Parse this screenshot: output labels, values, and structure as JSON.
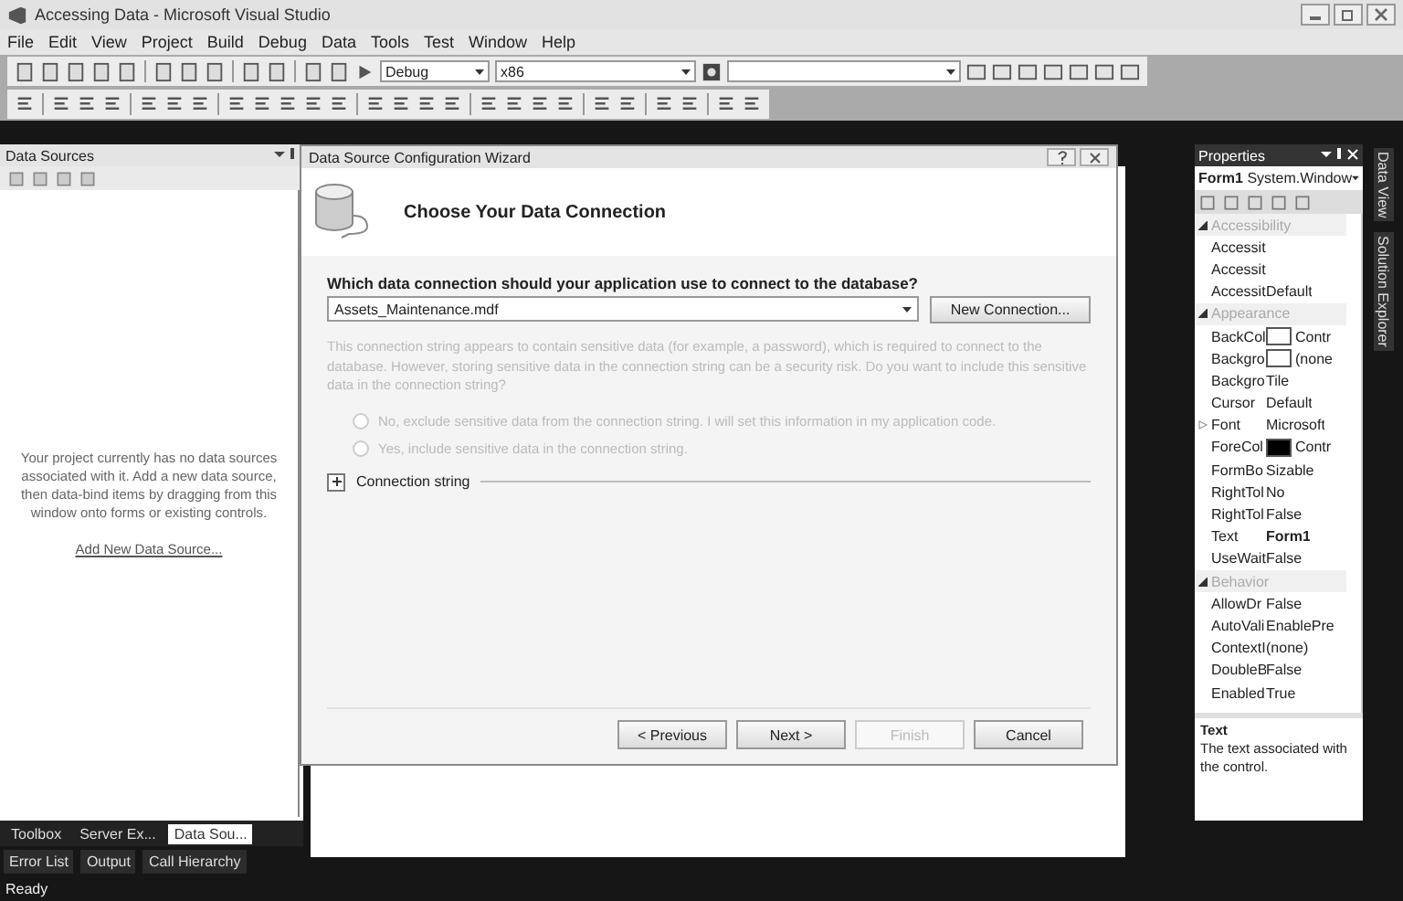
{
  "window": {
    "title": "Accessing Data - Microsoft Visual Studio"
  },
  "menu": [
    "File",
    "Edit",
    "View",
    "Project",
    "Build",
    "Debug",
    "Data",
    "Tools",
    "Test",
    "Window",
    "Help"
  ],
  "toolbar": {
    "configuration": "Debug",
    "platform": "x86"
  },
  "data_sources": {
    "title": "Data Sources",
    "message": "Your project currently has no data sources associated with it. Add a new data source, then data-bind items by dragging from this window onto forms or existing controls.",
    "link": "Add New Data Source...",
    "tabs": [
      {
        "label": "Toolbox",
        "selected": false
      },
      {
        "label": "Server Ex...",
        "selected": false
      },
      {
        "label": "Data Sou...",
        "selected": true
      }
    ]
  },
  "wizard": {
    "title": "Data Source Configuration Wizard",
    "heading": "Choose Your Data Connection",
    "question": "Which data connection should your application use to connect to the database?",
    "connection": "Assets_Maintenance.mdf",
    "new_connection": "New Connection...",
    "notice": "This connection string appears to contain sensitive data (for example, a password), which is required to connect to the database. However, storing sensitive data in the connection string can be a security risk. Do you want to include this sensitive data in the connection string?",
    "options": [
      {
        "label": "No, exclude sensitive data from the connection string. I will set this information in my application code.",
        "selected": false,
        "disabled": true
      },
      {
        "label": "Yes, include sensitive data in the connection string.",
        "selected": false,
        "disabled": true
      }
    ],
    "connection_string": {
      "label": "Connection string",
      "expanded": false
    },
    "buttons": [
      {
        "label": "< Previous",
        "disabled": false
      },
      {
        "label": "Next >",
        "disabled": false
      },
      {
        "label": "Finish",
        "disabled": true
      },
      {
        "label": "Cancel",
        "disabled": false
      }
    ]
  },
  "properties": {
    "title": "Properties",
    "object": "Form1",
    "type": "System.Window",
    "rows": [
      {
        "kind": "category",
        "name": "Accessibility",
        "expanded": true
      },
      {
        "kind": "property",
        "name": "Accessit"
      },
      {
        "kind": "property",
        "name": "Accessit"
      },
      {
        "kind": "property",
        "name": "Accessit",
        "value": "Default"
      },
      {
        "kind": "category",
        "name": "Appearance",
        "expanded": true
      },
      {
        "kind": "property",
        "name": "BackCol",
        "color": "#ffffff",
        "value": "Contr"
      },
      {
        "kind": "property",
        "name": "Backgro",
        "color": "#ffffff",
        "value": "(none"
      },
      {
        "kind": "property",
        "name": "Backgro",
        "value": "Tile"
      },
      {
        "kind": "property",
        "name": "Cursor",
        "value": "Default"
      },
      {
        "kind": "property",
        "name": "Font",
        "value": "Microsoft",
        "expandable": true
      },
      {
        "kind": "property",
        "name": "ForeCol",
        "color": "#000000",
        "value": "Contr"
      },
      {
        "kind": "property",
        "name": "FormBo",
        "value": "Sizable"
      },
      {
        "kind": "property",
        "name": "RightTol",
        "value": "No"
      },
      {
        "kind": "property",
        "name": "RightTol",
        "value": "False"
      },
      {
        "kind": "property",
        "name": "Text",
        "value": "Form1",
        "bold": true
      },
      {
        "kind": "property",
        "name": "UseWait",
        "value": "False"
      },
      {
        "kind": "category",
        "name": "Behavior",
        "expanded": true
      },
      {
        "kind": "property",
        "name": "AllowDr",
        "value": "False"
      },
      {
        "kind": "property",
        "name": "AutoVali",
        "value": "EnablePre"
      },
      {
        "kind": "property",
        "name": "ContextI",
        "value": "(none)"
      },
      {
        "kind": "property",
        "name": "DoubleB",
        "value": "False"
      },
      {
        "kind": "property",
        "name": "Enabled",
        "value": "True"
      }
    ],
    "description": {
      "title": "Text",
      "text": "The text associated with the control."
    }
  },
  "side_tabs": [
    "Data View",
    "Solution Explorer"
  ],
  "output_tabs": [
    "Error List",
    "Output",
    "Call Hierarchy"
  ],
  "status_bar": "Ready"
}
